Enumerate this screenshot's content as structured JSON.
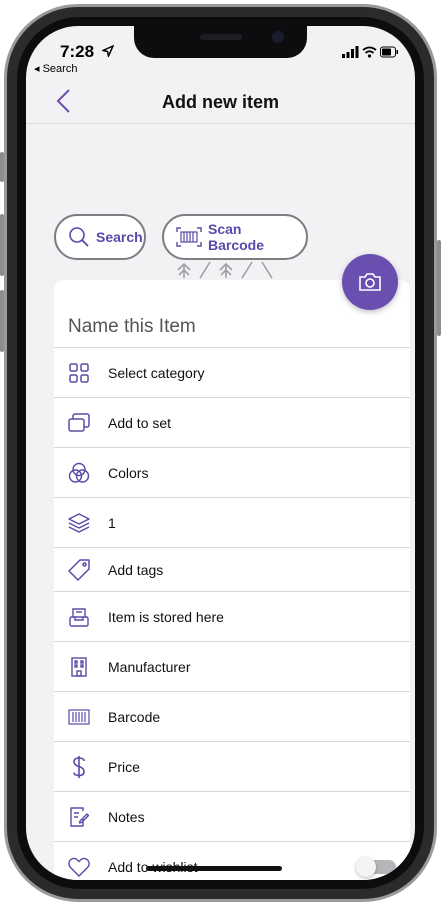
{
  "status_bar": {
    "time": "7:28",
    "back_app": "◂ Search"
  },
  "nav": {
    "title": "Add new item",
    "back_icon": "chevron-left-icon"
  },
  "chips": {
    "search_label": "Search",
    "scan_label": "Scan Barcode"
  },
  "camera_button": {
    "icon": "camera-icon"
  },
  "name_field": {
    "placeholder": "Name this Item",
    "value": ""
  },
  "rows": [
    {
      "label": "Select category",
      "icon": "grid-icon"
    },
    {
      "label": "Add to set",
      "icon": "stacked-cards-icon"
    },
    {
      "label": "Colors",
      "icon": "color-circles-icon"
    },
    {
      "label": "1",
      "icon": "layers-icon"
    },
    {
      "label": "Add tags",
      "icon": "tag-icon"
    },
    {
      "label": "Item is stored here",
      "icon": "tray-icon"
    },
    {
      "label": "Manufacturer",
      "icon": "building-icon"
    },
    {
      "label": "Barcode",
      "icon": "barcode-icon"
    },
    {
      "label": "Price",
      "icon": "dollar-icon"
    },
    {
      "label": "Notes",
      "icon": "notes-icon"
    },
    {
      "label": "Add to wishlist",
      "icon": "heart-icon"
    }
  ],
  "wishlist_toggle": {
    "on": false
  },
  "colors": {
    "accent": "#6a4fb0",
    "chip_text": "#5a4aa8",
    "divider": "#d8d8dc"
  }
}
